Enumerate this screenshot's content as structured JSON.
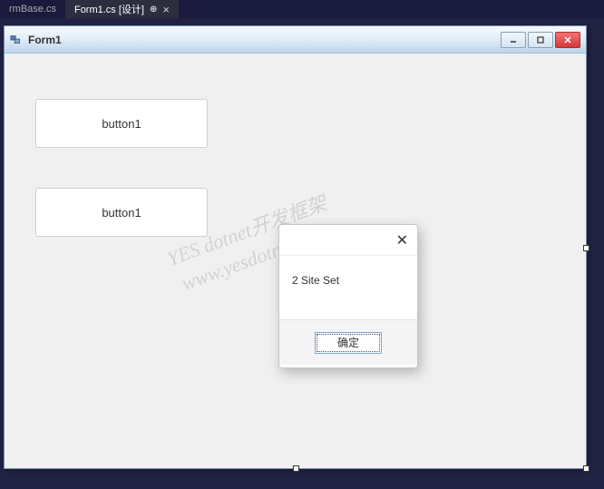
{
  "tabs": {
    "inactive": "rmBase.cs",
    "active": "Form1.cs [设计]"
  },
  "window": {
    "title": "Form1"
  },
  "buttons": {
    "button1": "button1",
    "button2": "button1"
  },
  "dialog": {
    "message": "2 Site Set",
    "ok": "确定"
  },
  "watermark": {
    "line1": "YES dotnet开发框架",
    "line2": "www.yesdotnet.com"
  }
}
